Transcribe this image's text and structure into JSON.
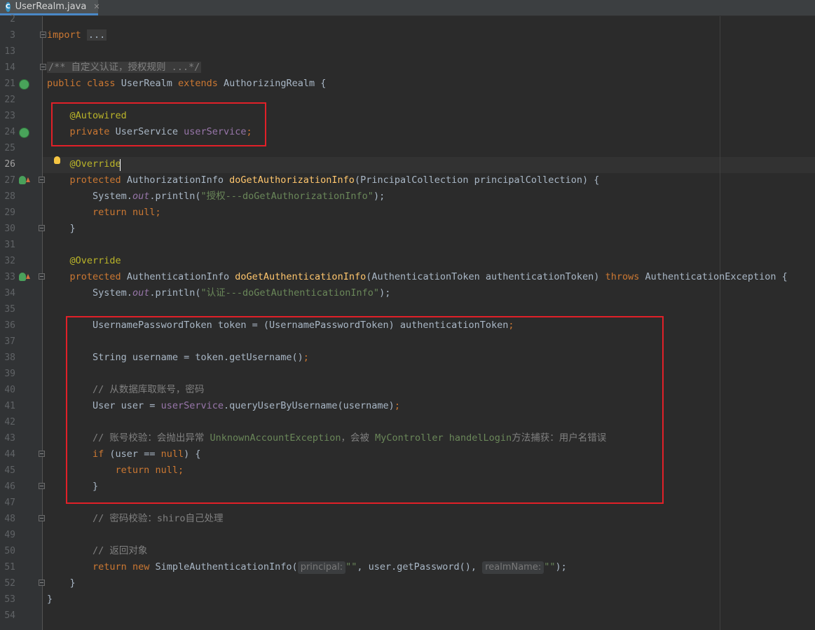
{
  "tab": {
    "icon_letter": "C",
    "filename": "UserRealm.java",
    "close": "✕"
  },
  "line_numbers": [
    "2",
    "3",
    "13",
    "14",
    "21",
    "22",
    "23",
    "24",
    "25",
    "26",
    "27",
    "28",
    "29",
    "30",
    "31",
    "32",
    "33",
    "34",
    "35",
    "36",
    "37",
    "38",
    "39",
    "40",
    "41",
    "42",
    "43",
    "44",
    "45",
    "46",
    "47",
    "48",
    "49",
    "50",
    "51",
    "52",
    "53",
    "54"
  ],
  "current_line": "26",
  "code": {
    "l3_import": "import",
    "l3_fold": "...",
    "l14_doc": "/** 自定义认证，授权规则 ...*/",
    "l21_public": "public",
    "l21_class": "class",
    "l21_name": "UserRealm",
    "l21_extends": "extends",
    "l21_super": "AuthorizingRealm {",
    "l23_autowired": "@Autowired",
    "l24_private": "private",
    "l24_type": "UserService",
    "l24_field": "userService",
    "l24_semi": ";",
    "l26_override": "@Override",
    "l27_protected": "protected",
    "l27_ret": "AuthorizationInfo",
    "l27_method": "doGetAuthorizationInfo",
    "l27_params": "(PrincipalCollection principalCollection) {",
    "l28_sys": "System.",
    "l28_out": "out",
    "l28_println": ".println(",
    "l28_str": "\"授权---doGetAuthorizationInfo\"",
    "l28_end": ");",
    "l29_return": "return",
    "l29_null": "null",
    "l29_semi": ";",
    "l30_brace": "}",
    "l32_override": "@Override",
    "l33_protected": "protected",
    "l33_ret": "AuthenticationInfo",
    "l33_method": "doGetAuthenticationInfo",
    "l33_params": "(AuthenticationToken authenticationToken)",
    "l33_throws": "throws",
    "l33_exc": "AuthenticationException {",
    "l34_sys": "System.",
    "l34_out": "out",
    "l34_println": ".println(",
    "l34_str": "\"认证---doGetAuthenticationInfo\"",
    "l34_end": ");",
    "l36_code": "UsernamePasswordToken token = (UsernamePasswordToken) authenticationToken",
    "l36_semi": ";",
    "l38_code": "String username = token.getUsername()",
    "l38_semi": ";",
    "l40_comment": "// 从数据库取账号，密码",
    "l41_a": "User user = ",
    "l41_field": "userService",
    "l41_b": ".queryUserByUsername(username)",
    "l41_semi": ";",
    "l43_comment_a": "// 账号校验：会抛出异常 ",
    "l43_comment_b": "UnknownAccountException",
    "l43_comment_c": "，会被 ",
    "l43_comment_d": "MyController handelLogin",
    "l43_comment_e": "方法捕获：用户名错误",
    "l44_if": "if",
    "l44_a": " (user == ",
    "l44_null": "null",
    "l44_b": ") {",
    "l45_return": "return",
    "l45_null": "null",
    "l45_semi": ";",
    "l46_brace": "}",
    "l48_comment": "// 密码校验：shiro自己处理",
    "l50_comment": "// 返回对象",
    "l51_return": "return",
    "l51_new": "new",
    "l51_call": "SimpleAuthenticationInfo(",
    "l51_hint1": "principal:",
    "l51_str1": "\"\"",
    "l51_mid": ", user.getPassword(), ",
    "l51_hint2": "realmName:",
    "l51_str2": "\"\"",
    "l51_end": ");",
    "l52_brace": "}",
    "l53_brace": "}"
  },
  "colors": {
    "highlight_box": "#e12028",
    "keyword": "#cc7832",
    "annotation": "#bbb529",
    "string": "#6a8759"
  }
}
